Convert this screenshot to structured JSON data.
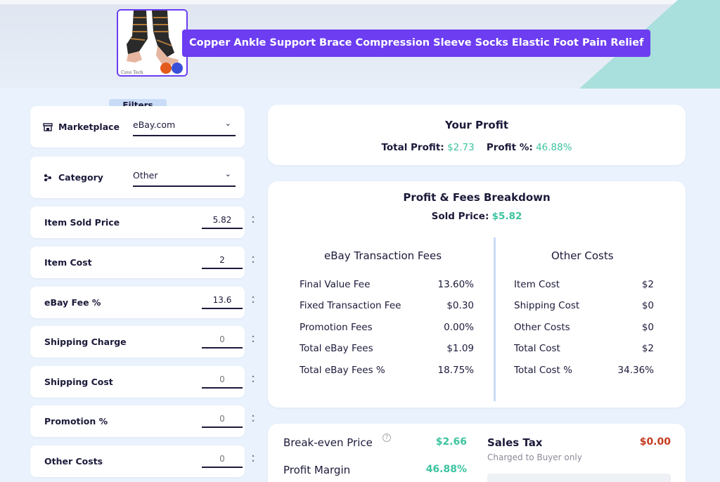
{
  "product": {
    "title": "Copper Ankle Support Brace Compression Sleeve Socks Elastic Foot Pain Relief",
    "thumb_caption": "Cuve Tech"
  },
  "filters": {
    "label": "Filters",
    "marketplace": {
      "label": "Marketplace",
      "value": "eBay.com",
      "icon": "store-icon"
    },
    "category": {
      "label": "Category",
      "value": "Other",
      "icon": "category-icon"
    },
    "fields": [
      {
        "label": "Item Sold Price",
        "value": "5.82"
      },
      {
        "label": "Item Cost",
        "value": "2"
      },
      {
        "label": "eBay Fee %",
        "value": "13.6"
      },
      {
        "label": "Shipping Charge",
        "value": "0"
      },
      {
        "label": "Shipping Cost",
        "value": "0"
      },
      {
        "label": "Promotion %",
        "value": "0"
      },
      {
        "label": "Other Costs",
        "value": "0"
      }
    ]
  },
  "profit": {
    "title": "Your Profit",
    "total_label": "Total Profit:",
    "total_value": "$2.73",
    "pct_label": "Profit %:",
    "pct_value": "46.88%"
  },
  "breakdown": {
    "title": "Profit & Fees Breakdown",
    "sold_label": "Sold Price:",
    "sold_value": "$5.82",
    "fees_title": "eBay Transaction Fees",
    "fees": [
      {
        "label": "Final Value Fee",
        "value": "13.60%"
      },
      {
        "label": "Fixed Transaction Fee",
        "value": "$0.30"
      },
      {
        "label": "Promotion Fees",
        "value": "0.00%"
      },
      {
        "label": "Total eBay Fees",
        "value": "$1.09"
      },
      {
        "label": "Total eBay Fees %",
        "value": "18.75%"
      }
    ],
    "costs_title": "Other Costs",
    "costs": [
      {
        "label": "Item Cost",
        "value": "$2"
      },
      {
        "label": "Shipping Cost",
        "value": "$0"
      },
      {
        "label": "Other Costs",
        "value": "$0"
      },
      {
        "label": "Total Cost",
        "value": "$2"
      },
      {
        "label": "Total Cost %",
        "value": "34.36%"
      }
    ]
  },
  "summary": {
    "breakeven_label": "Break-even Price",
    "breakeven_value": "$2.66",
    "margin_label": "Profit Margin",
    "margin_value": "46.88%",
    "tax_label": "Sales Tax",
    "tax_value": "$0.00",
    "tax_note": "Charged to Buyer only"
  },
  "colors": {
    "accent": "#6c3df1",
    "positive": "#3dc4a0",
    "negative": "#c53b1f",
    "background": "#eaf2fd"
  }
}
